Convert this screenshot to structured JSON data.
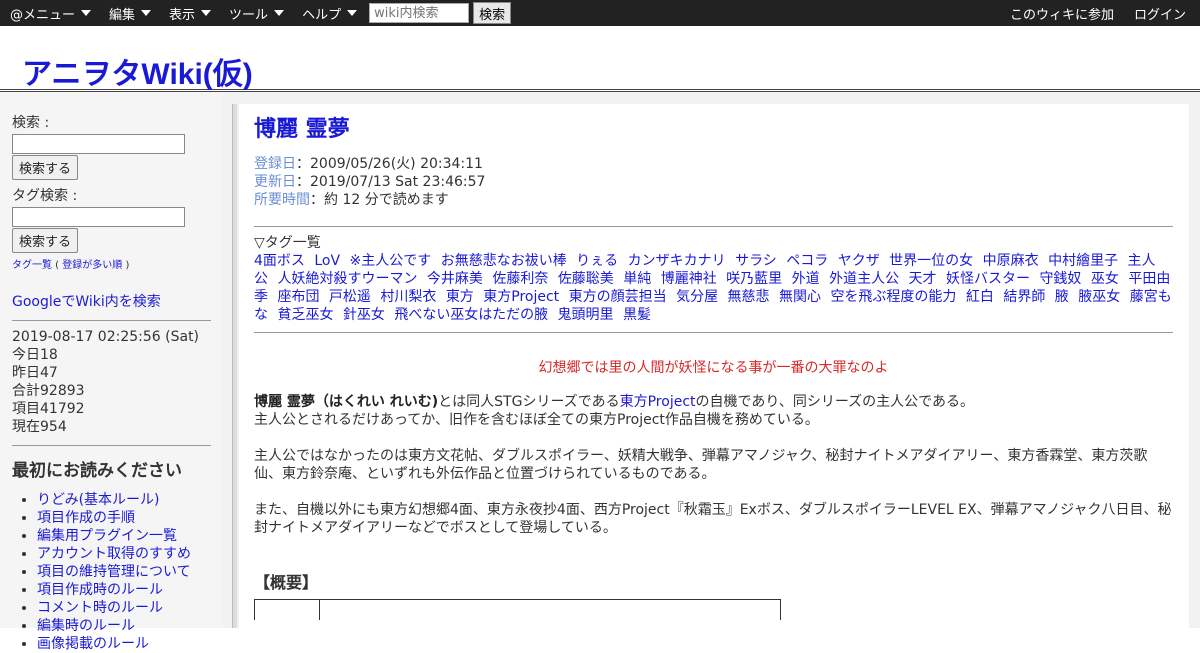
{
  "topbar": {
    "menus": [
      "@メニュー",
      "編集",
      "表示",
      "ツール",
      "ヘルプ"
    ],
    "search_placeholder": "wiki内検索",
    "search_button": "検索",
    "join": "このウィキに参加",
    "login": "ログイン"
  },
  "header": {
    "title": "アニヲタWiki(仮)"
  },
  "sidebar": {
    "search_label": "検索 :",
    "search_button": "検索する",
    "tag_search_label": "タグ検索 :",
    "tag_search_button": "検索する",
    "tag_list": "タグ一覧",
    "tag_list_popular": "登録が多い順",
    "google_search": "GoogleでWiki内を検索",
    "stats": {
      "datetime": "2019-08-17 02:25:56 (Sat)",
      "today": "今日18",
      "yesterday": "昨日47",
      "total": "合計92893",
      "items": "項目41792",
      "now": "現在954"
    },
    "read_first": "最初にお読みください",
    "links": [
      "りどみ(基本ルール)",
      "項目作成の手順",
      "編集用プラグイン一覧",
      "アカウント取得のすすめ",
      "項目の維持管理について",
      "項目作成時のルール",
      "コメント時のルール",
      "編集時のルール",
      "画像掲載のルール"
    ]
  },
  "main": {
    "title": "博麗 霊夢",
    "registered_label": "登録日",
    "registered": "：2009/05/26(火) 20:34:11",
    "updated_label": "更新日",
    "updated": "：2019/07/13 Sat 23:46:57",
    "read_time_label": "所要時間",
    "read_time": "：約 12 分で読めます",
    "tag_heading": "▽タグ一覧",
    "tags": [
      "4面ボス",
      "LoV",
      "※主人公です",
      "お無慈悲なお祓い棒",
      "りぇる",
      "カンザキカナリ",
      "サラシ",
      "ペコラ",
      "ヤクザ",
      "世界一位の女",
      "中原麻衣",
      "中村繪里子",
      "主人公",
      "人妖絶対殺すウーマン",
      "今井麻美",
      "佐藤利奈",
      "佐藤聡美",
      "単純",
      "博麗神社",
      "咲乃藍里",
      "外道",
      "外道主人公",
      "天才",
      "妖怪バスター",
      "守銭奴",
      "巫女",
      "平田由季",
      "座布団",
      "戸松遥",
      "村川梨衣",
      "東方",
      "東方Project",
      "東方の顔芸担当",
      "気分屋",
      "無慈悲",
      "無関心",
      "空を飛ぶ程度の能力",
      "紅白",
      "結界師",
      "腋",
      "腋巫女",
      "藤宮もな",
      "貧乏巫女",
      "針巫女",
      "飛べない巫女はただの腋",
      "鬼頭明里",
      "黒髪"
    ],
    "quote": "幻想郷では里の人間が妖怪になる事が一番の大罪なのよ",
    "p1_bold": "博麗 霊夢（はくれい れいむ)",
    "p1_a": "とは同人STGシリーズである",
    "p1_link": "東方Project",
    "p1_b": "の自機であり、同シリーズの主人公である。",
    "p1_c": "主人公とされるだけあってか、旧作を含むほぼ全ての東方Project作品自機を務めている。",
    "p2": "主人公ではなかったのは東方文花帖、ダブルスポイラー、妖精大戦争、弾幕アマノジャク、秘封ナイトメアダイアリー、東方香霖堂、東方茨歌仙、東方鈴奈庵、といずれも外伝作品と位置づけられているものである。",
    "p3": "また、自機以外にも東方幻想郷4面、東方永夜抄4面、西方Project『秋霜玉』Exボス、ダブルスポイラーLEVEL EX、弾幕アマノジャク八日目、秘封ナイトメアダイアリーなどでボスとして登場している。",
    "section": "【概要】"
  }
}
